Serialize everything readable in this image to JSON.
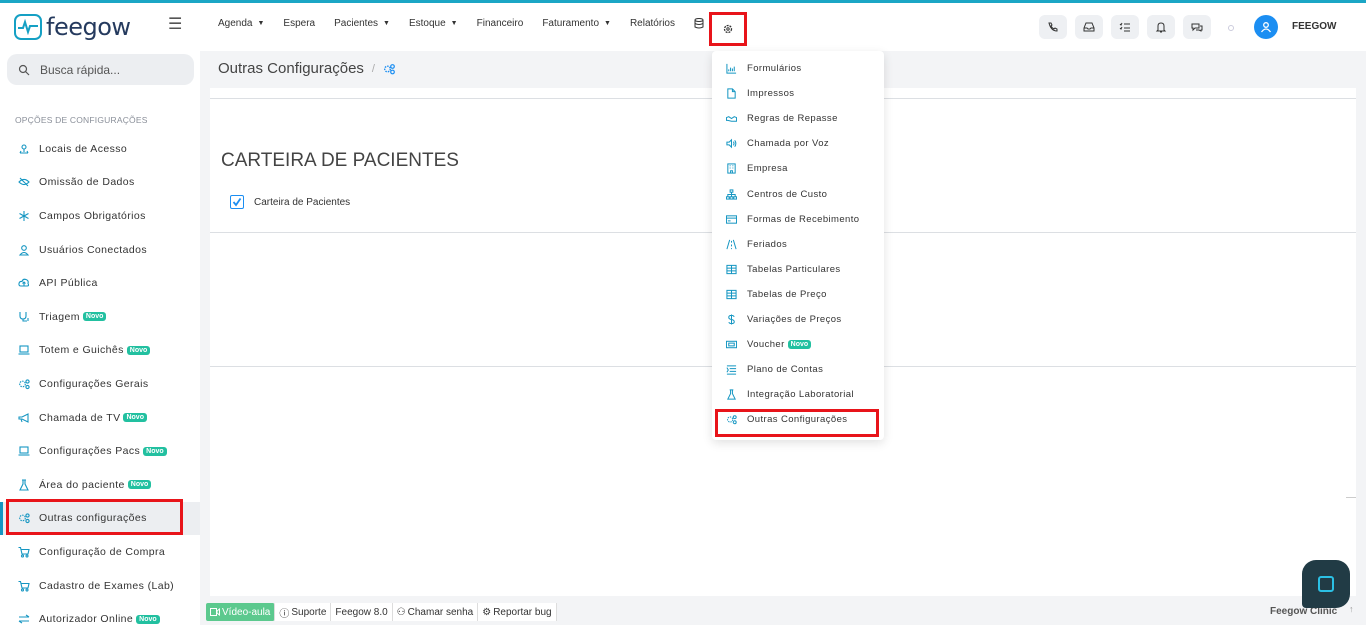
{
  "brand": {
    "name": "feegow"
  },
  "nav": {
    "items": [
      {
        "label": "Agenda",
        "dropdown": true
      },
      {
        "label": "Espera",
        "dropdown": false
      },
      {
        "label": "Pacientes",
        "dropdown": true
      },
      {
        "label": "Estoque",
        "dropdown": true
      },
      {
        "label": "Financeiro",
        "dropdown": false
      },
      {
        "label": "Faturamento",
        "dropdown": true
      },
      {
        "label": "Relatórios",
        "dropdown": false
      }
    ]
  },
  "header": {
    "user_name": "FEEGOW"
  },
  "search": {
    "placeholder": "Busca rápida..."
  },
  "sidebar": {
    "heading": "OPÇÕES DE CONFIGURAÇÕES",
    "items": [
      {
        "label": "Locais de Acesso",
        "icon": "location-icon",
        "badge": ""
      },
      {
        "label": "Omissão de Dados",
        "icon": "eye-off-icon",
        "badge": ""
      },
      {
        "label": "Campos Obrigatórios",
        "icon": "asterisk-icon",
        "badge": ""
      },
      {
        "label": "Usuários Conectados",
        "icon": "user-icon",
        "badge": ""
      },
      {
        "label": "API Pública",
        "icon": "cloud-upload-icon",
        "badge": ""
      },
      {
        "label": "Triagem",
        "icon": "stethoscope-icon",
        "badge": "Novo"
      },
      {
        "label": "Totem e Guichês",
        "icon": "laptop-icon",
        "badge": "Novo"
      },
      {
        "label": "Configurações Gerais",
        "icon": "gears-icon",
        "badge": ""
      },
      {
        "label": "Chamada de TV",
        "icon": "megaphone-icon",
        "badge": "Novo"
      },
      {
        "label": "Configurações Pacs",
        "icon": "laptop-icon",
        "badge": "Novo"
      },
      {
        "label": "Área do paciente",
        "icon": "flask-icon",
        "badge": "Novo"
      },
      {
        "label": "Outras configurações",
        "icon": "gears-icon",
        "badge": "",
        "active": true
      },
      {
        "label": "Configuração de Compra",
        "icon": "cart-icon",
        "badge": ""
      },
      {
        "label": "Cadastro de Exames (Lab)",
        "icon": "cart-icon",
        "badge": ""
      },
      {
        "label": "Autorizador Online",
        "icon": "transfer-icon",
        "badge": "Novo"
      }
    ]
  },
  "breadcrumb": {
    "title": "Outras Configurações",
    "separator": "/"
  },
  "main": {
    "section_title": "CARTEIRA DE PACIENTES",
    "checkbox_label": "Carteira de Pacientes",
    "checkbox_checked": true
  },
  "dropdown": {
    "items": [
      {
        "label": "Formulários",
        "icon": "chart-icon",
        "badge": ""
      },
      {
        "label": "Impressos",
        "icon": "file-icon",
        "badge": ""
      },
      {
        "label": "Regras de Repasse",
        "icon": "handshake-icon",
        "badge": ""
      },
      {
        "label": "Chamada por Voz",
        "icon": "speaker-icon",
        "badge": ""
      },
      {
        "label": "Empresa",
        "icon": "building-icon",
        "badge": ""
      },
      {
        "label": "Centros de Custo",
        "icon": "sitemap-icon",
        "badge": ""
      },
      {
        "label": "Formas de Recebimento",
        "icon": "credit-card-icon",
        "badge": ""
      },
      {
        "label": "Feriados",
        "icon": "road-icon",
        "badge": ""
      },
      {
        "label": "Tabelas Particulares",
        "icon": "table-icon",
        "badge": ""
      },
      {
        "label": "Tabelas de Preço",
        "icon": "table-icon",
        "badge": ""
      },
      {
        "label": "Variações de Preços",
        "icon": "dollar-icon",
        "badge": ""
      },
      {
        "label": "Voucher",
        "icon": "ticket-icon",
        "badge": "Novo"
      },
      {
        "label": "Plano de Contas",
        "icon": "list-icon",
        "badge": ""
      },
      {
        "label": "Integração Laboratorial",
        "icon": "flask-icon",
        "badge": ""
      },
      {
        "label": "Outras Configurações",
        "icon": "gears-icon",
        "badge": "",
        "highlighted": true
      }
    ]
  },
  "footer": {
    "video": "Vídeo-aula",
    "support": "Suporte",
    "version": "Feegow 8.0",
    "call": "Chamar senha",
    "bug": "Reportar bug",
    "brand": "Feegow Clinic"
  },
  "colors": {
    "accent": "#1b8ef2",
    "highlight": "#e8141a",
    "badge": "#22c0a0",
    "brand": "#15a0c4"
  }
}
